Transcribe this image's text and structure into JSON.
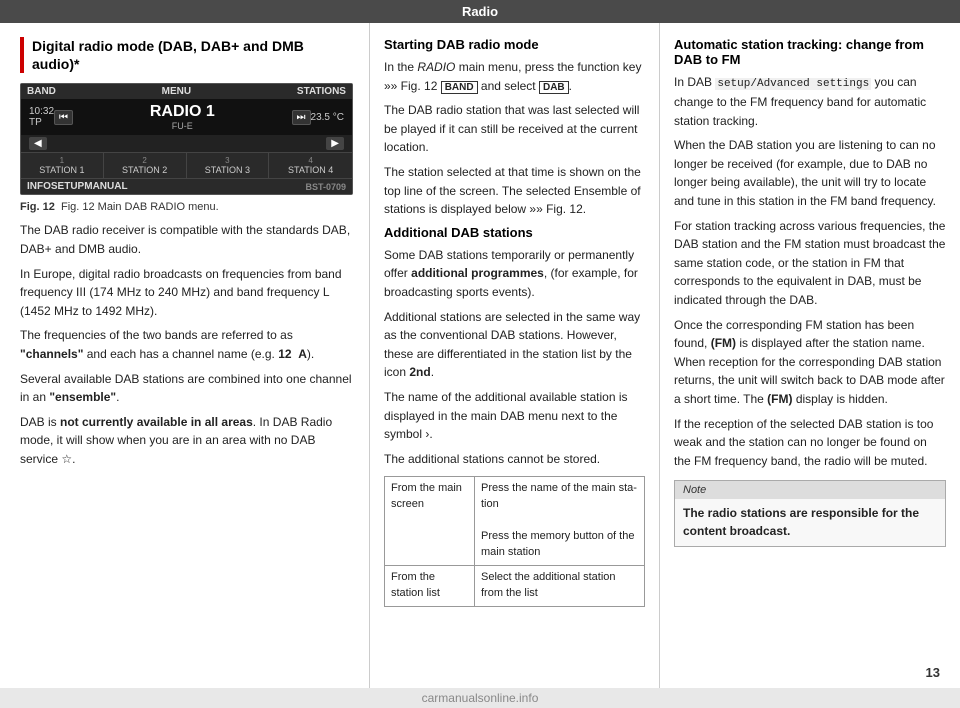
{
  "header": {
    "title": "Radio"
  },
  "left": {
    "section_title": "Digital radio mode (DAB, DAB+ and DMB audio)*",
    "radio_ui": {
      "band": "BAND",
      "menu": "MENU",
      "stations": "STATIONS",
      "time": "10:32",
      "tp": "TP",
      "radio_name": "RADIO 1",
      "radio_sub": "FU-E",
      "temp": "23.5 °C",
      "station_labels": [
        "STATION 1",
        "STATION 2",
        "STATION 3",
        "STATION 4"
      ],
      "station_nums": [
        "1",
        "2",
        "3",
        "4"
      ],
      "info": "INFO",
      "setup": "SETUP",
      "manual": "MANUAL",
      "code": "BST-0709"
    },
    "fig_caption": "Fig. 12  Main DAB RADIO menu.",
    "paragraphs": [
      "The DAB radio receiver is compatible with the standards DAB, DAB+ and DMB audio.",
      "In Europe, digital radio broadcasts on fre­quencies from band frequency III (174 MHz to 240 MHz) and band frequency L (1452 MHz to 1492 MHz).",
      "The frequencies of the two bands are referred to as \"channels\" and each has a channel name (e.g. 12  A).",
      "Several available DAB stations are combined into one channel in an \"ensemble\".",
      "DAB is not currently available in all areas. In DAB Radio mode, it will show when you are in an area with no DAB service ☆."
    ]
  },
  "mid": {
    "heading1": "Starting DAB radio mode",
    "para1": "In the RADIO main menu, press the function key »» Fig. 12  BAND  and select  DAB .",
    "para2": "The DAB radio station that was last selected will be played if it can still be received at the current location.",
    "para3": "The station selected at that time is shown on the top line of the screen. The selected En­semble of stations is displayed below »» Fig. 12.",
    "heading2": "Additional DAB stations",
    "para4": "Some DAB stations temporarily or perma­nently offer additional programmes, (for ex­ample, for broadcasting sports events).",
    "para5": "Additional stations are selected in the same way as the conventional DAB stations. How­ever, these are differentiated in the station list by the icon 2nd.",
    "para6": "The name of the additional available station is displayed in the main DAB menu next to the symbol ›.",
    "para7": "The additional stations cannot be stored.",
    "table": {
      "rows": [
        {
          "col1": "From the main screen",
          "col2a": "Press the name of the main sta­tion",
          "col2b": "Press the memory button of the main station"
        },
        {
          "col1": "From the station list",
          "col2a": "Select the additional station from the list",
          "col2b": ""
        }
      ]
    }
  },
  "right": {
    "heading1": "Automatic station tracking: change from DAB to FM",
    "para1_prefix": "In DAB ",
    "para1_code": "setup/Advanced settings",
    "para1_suffix": " you can change to the FM frequency band for au­tomatic station tracking.",
    "para2": "When the DAB station you are listening to can no longer be received (for example, due to DAB no longer being available), the unit will try to locate and tune in this station in the FM band frequency.",
    "para3": "For station tracking across various frequen­cies, the DAB station and the FM station must broadcast the same station code, or the sta­tion in FM that corresponds to the equivalent in DAB, must be indicated through the DAB.",
    "para4": "Once the corresponding FM station has been found, (FM) is displayed after the station name. When reception for the corresponding DAB station returns, the unit will switch back to DAB mode after a short time. The (FM) display is hidden.",
    "para5": "If the reception of the selected DAB station is too weak and the station can no longer be found on the FM frequency band, the radio will be muted.",
    "note": {
      "header": "Note",
      "body": "The radio stations are responsible for the content broadcast."
    }
  },
  "page_number": "13",
  "watermark": "carmanualsonline.info"
}
